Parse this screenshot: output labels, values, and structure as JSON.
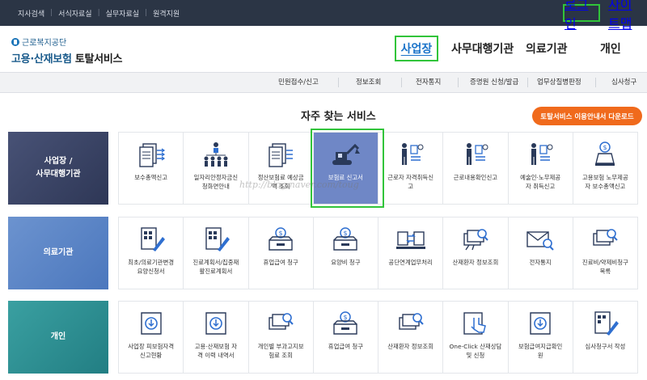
{
  "topbar": {
    "links": [
      "지사검색",
      "서식자료실",
      "실무자료실",
      "원격지원"
    ],
    "login": "로그인",
    "sitemap": "사이트맵"
  },
  "logo": {
    "org": "근로복지공단",
    "name_blue": "고용·산재보험",
    "name_dark": "토탈서비스"
  },
  "mainnav": {
    "business": "사업장",
    "agency": "사무대행기관",
    "medical": "의료기관",
    "personal": "개인"
  },
  "submenu": [
    "민원접수/신고",
    "정보조회",
    "전자통지",
    "증명원 신청/발급",
    "업무상질병판정",
    "심사청구"
  ],
  "section": {
    "title": "자주 찾는 서비스",
    "guide_button": "토탈서비스 이용안내서 다운로드"
  },
  "rows": [
    {
      "title": "사업장 /\n사무대행기관",
      "items": [
        {
          "label": "보수총액신고",
          "icon": "document-list-icon"
        },
        {
          "label": "일자리안정자금신\n청화면안내",
          "icon": "people-org-icon"
        },
        {
          "label": "정산보험료 예상금\n액 조회",
          "icon": "document-list-icon"
        },
        {
          "label": "보험료 신고서",
          "icon": "excavator-icon"
        },
        {
          "label": "근로자 자격취득신\n고",
          "icon": "worker-id-icon"
        },
        {
          "label": "근로내용확인신고",
          "icon": "worker-id-icon"
        },
        {
          "label": "예술인·노무제공\n자 취득신고",
          "icon": "worker-id-icon"
        },
        {
          "label": "고용보험 노무제공\n자 보수총액신고",
          "icon": "money-bag-icon"
        }
      ]
    },
    {
      "title": "의료기관",
      "items": [
        {
          "label": "최초/의료기관변경\n요양신청서",
          "icon": "form-pen-icon"
        },
        {
          "label": "진료계획서/집중재\n활진료계획서",
          "icon": "form-pen-icon"
        },
        {
          "label": "휴업급여 청구",
          "icon": "money-box-icon"
        },
        {
          "label": "요양비 청구",
          "icon": "money-box-icon"
        },
        {
          "label": "공단연계업무처리",
          "icon": "transfer-icon"
        },
        {
          "label": "산재환자 정보조회",
          "icon": "search-card-icon"
        },
        {
          "label": "전자통지",
          "icon": "mail-search-icon"
        },
        {
          "label": "진료비/약제비청구\n목록",
          "icon": "search-card-icon"
        }
      ]
    },
    {
      "title": "개인",
      "items": [
        {
          "label": "사업장 피보험자격\n신고현황",
          "icon": "inbox-download-icon"
        },
        {
          "label": "고용·산재보험 자\n격 이력 내역서",
          "icon": "inbox-download-icon"
        },
        {
          "label": "개인별 부과고지보\n험료 조회",
          "icon": "search-card-icon"
        },
        {
          "label": "휴업급여 청구",
          "icon": "money-box-icon"
        },
        {
          "label": "산재환자 정보조회",
          "icon": "search-card-icon"
        },
        {
          "label": "One-Click 산재상담\n및 신청",
          "icon": "click-hand-icon"
        },
        {
          "label": "보험급여지급확인\n원",
          "icon": "inbox-download-icon"
        },
        {
          "label": "심사청구서 작성",
          "icon": "form-pen-icon"
        }
      ]
    }
  ],
  "watermark": "http://blog.naver.com/toug",
  "colors": {
    "topbar": "#2b3545",
    "accent_green_highlight": "#31c43a",
    "active_card": "#6f87c6",
    "guide_button": "#f06a1c",
    "brand_blue": "#1a5b8c"
  }
}
